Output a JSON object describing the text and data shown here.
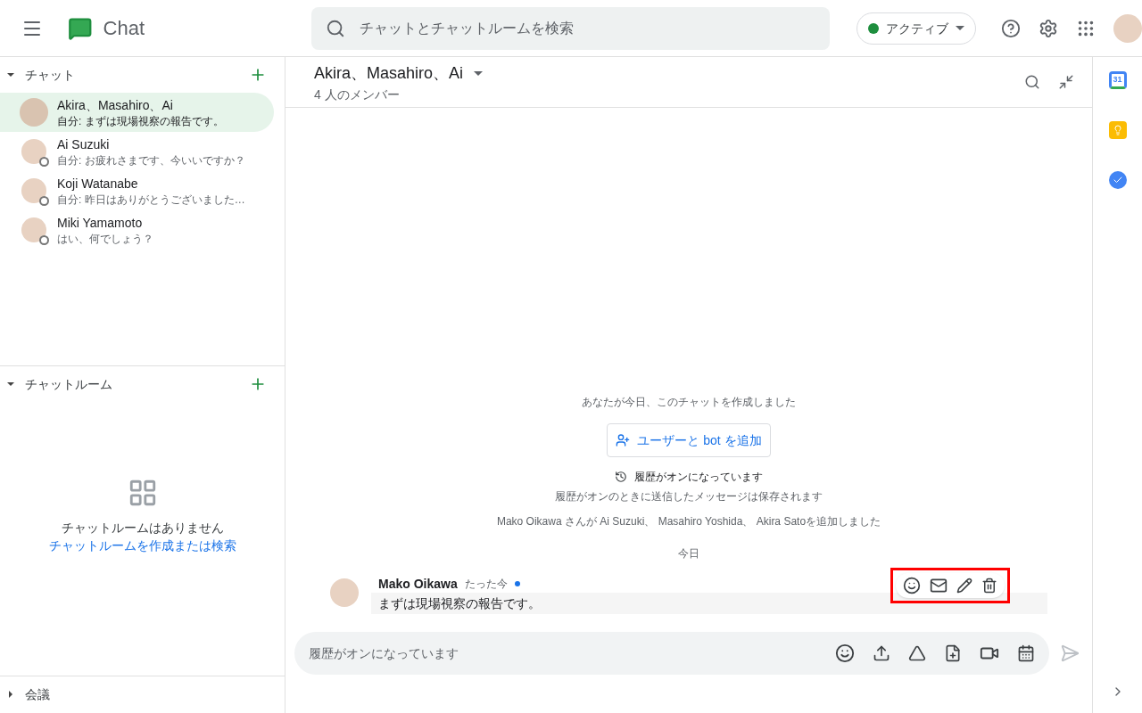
{
  "header": {
    "app_name": "Chat",
    "search_placeholder": "チャットとチャットルームを検索",
    "status": {
      "label": "アクティブ",
      "color": "#1e8e3e"
    }
  },
  "sidebar": {
    "chats": {
      "title": "チャット",
      "expanded": true,
      "items": [
        {
          "kind": "group",
          "name": "Akira、Masahiro、Ai",
          "preview": "自分: まずは現場視察の報告です。",
          "selected": true
        },
        {
          "kind": "person",
          "name": "Ai Suzuki",
          "preview": "自分: お疲れさまです、今いいですか？",
          "selected": false
        },
        {
          "kind": "person",
          "name": "Koji Watanabe",
          "preview": "自分: 昨日はありがとうございました…",
          "selected": false
        },
        {
          "kind": "person",
          "name": "Miki Yamamoto",
          "preview": "はい、何でしょう？",
          "selected": false
        }
      ]
    },
    "rooms": {
      "title": "チャットルーム",
      "expanded": true,
      "empty_text": "チャットルームはありません",
      "link": "チャットルームを作成または検索"
    },
    "meetings": {
      "title": "会議",
      "expanded": false
    }
  },
  "conversation": {
    "title": "Akira、Masahiro、Ai",
    "subtitle": "4 人のメンバー",
    "events": [
      {
        "kind": "note",
        "text": "あなたが今日、このチャットを作成しました"
      },
      {
        "kind": "button",
        "text": "ユーザーと bot を追加"
      },
      {
        "kind": "history",
        "title": "履歴がオンになっています",
        "text": "履歴がオンのときに送信したメッセージは保存されます"
      },
      {
        "kind": "note",
        "text": "Mako Oikawa さんが Ai Suzuki、 Masahiro Yoshida、 Akira Satoを追加しました"
      },
      {
        "kind": "date",
        "text": "今日"
      }
    ],
    "message": {
      "author": "Mako Oikawa",
      "time": "たった今",
      "unread": true,
      "text": "まずは現場視察の報告です。",
      "actions_highlighted": true
    },
    "composer_placeholder": "履歴がオンになっています"
  },
  "rail": {
    "calendar_day": "31"
  }
}
